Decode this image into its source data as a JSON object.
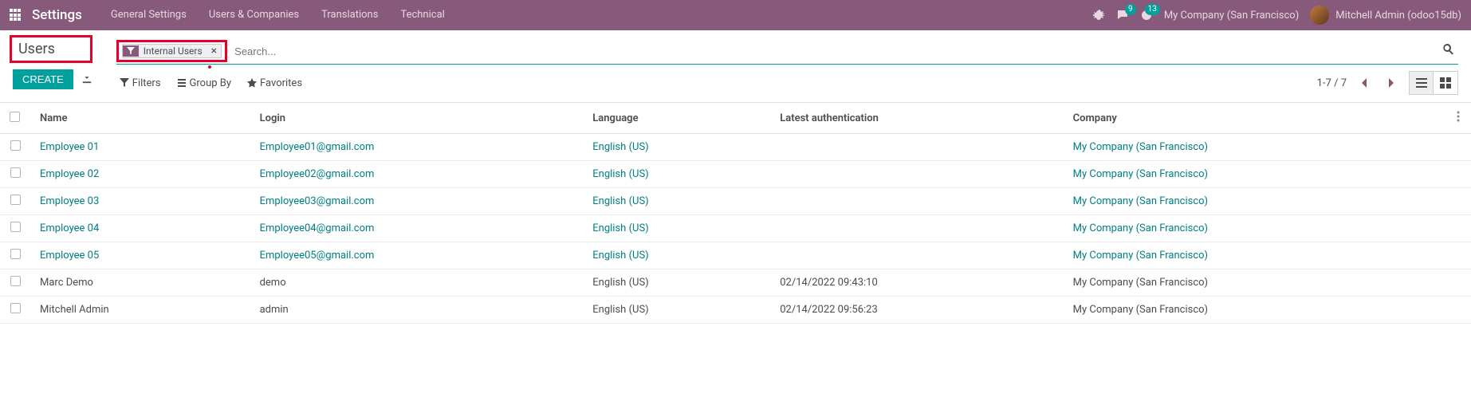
{
  "nav": {
    "app_name": "Settings",
    "menus": [
      "General Settings",
      "Users & Companies",
      "Translations",
      "Technical"
    ],
    "chat_badge": "9",
    "activity_badge": "13",
    "company": "My Company (San Francisco)",
    "user": "Mitchell Admin (odoo15db)"
  },
  "breadcrumb": {
    "title": "Users"
  },
  "buttons": {
    "create": "CREATE"
  },
  "search": {
    "filter_label": "Internal Users",
    "placeholder": "Search..."
  },
  "toolbar": {
    "filters": "Filters",
    "group_by": "Group By",
    "favorites": "Favorites",
    "pager": "1-7 / 7"
  },
  "table": {
    "headers": {
      "name": "Name",
      "login": "Login",
      "language": "Language",
      "latest_auth": "Latest authentication",
      "company": "Company"
    },
    "rows": [
      {
        "name": "Employee 01",
        "login": "Employee01@gmail.com",
        "language": "English (US)",
        "latest_auth": "",
        "company": "My Company (San Francisco)",
        "link": true
      },
      {
        "name": "Employee 02",
        "login": "Employee02@gmail.com",
        "language": "English (US)",
        "latest_auth": "",
        "company": "My Company (San Francisco)",
        "link": true
      },
      {
        "name": "Employee 03",
        "login": "Employee03@gmail.com",
        "language": "English (US)",
        "latest_auth": "",
        "company": "My Company (San Francisco)",
        "link": true
      },
      {
        "name": "Employee 04",
        "login": "Employee04@gmail.com",
        "language": "English (US)",
        "latest_auth": "",
        "company": "My Company (San Francisco)",
        "link": true
      },
      {
        "name": "Employee 05",
        "login": "Employee05@gmail.com",
        "language": "English (US)",
        "latest_auth": "",
        "company": "My Company (San Francisco)",
        "link": true
      },
      {
        "name": "Marc Demo",
        "login": "demo",
        "language": "English (US)",
        "latest_auth": "02/14/2022 09:43:10",
        "company": "My Company (San Francisco)",
        "link": false
      },
      {
        "name": "Mitchell Admin",
        "login": "admin",
        "language": "English (US)",
        "latest_auth": "02/14/2022 09:56:23",
        "company": "My Company (San Francisco)",
        "link": false
      }
    ]
  }
}
